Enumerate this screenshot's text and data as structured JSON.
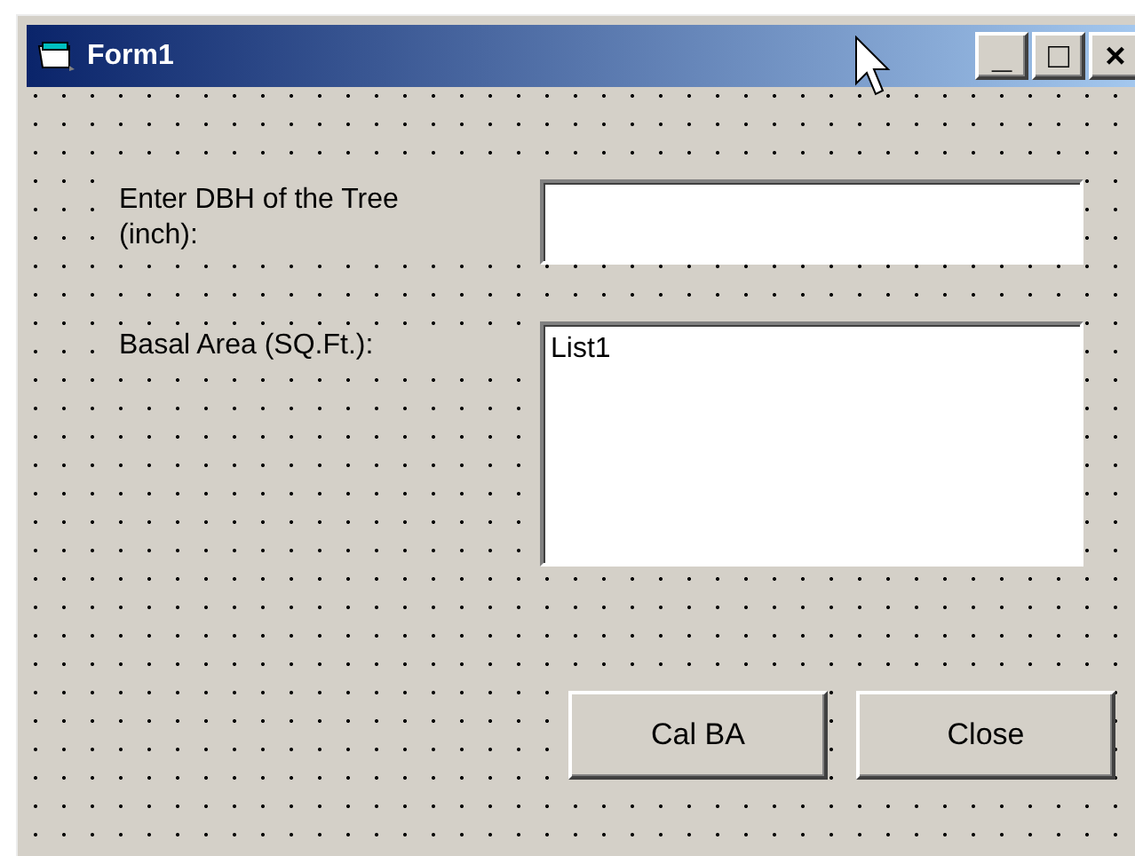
{
  "window": {
    "title": "Form1",
    "controls": [
      "_",
      "□",
      "×"
    ]
  },
  "labels": [
    {
      "text": "Enter DBH of the Tree (inch):"
    },
    {
      "text": "Basal Area (SQ.Ft.):"
    }
  ],
  "listbox": {
    "items": [
      "List1"
    ]
  },
  "buttons": [
    "Cal BA",
    "Close"
  ]
}
